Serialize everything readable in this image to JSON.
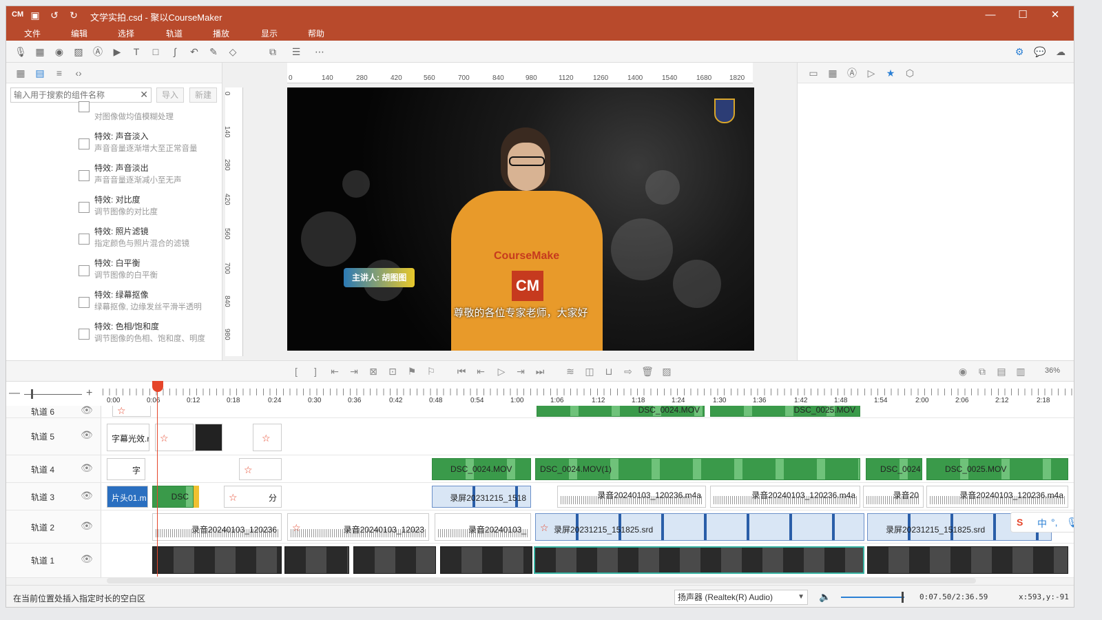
{
  "titlebar": {
    "logo": "CM",
    "title": "文学实拍.csd - 聚以CourseMaker",
    "minimize": "—",
    "maximize": "☐",
    "close": "✕"
  },
  "menu": [
    "文件",
    "编辑",
    "选择",
    "轨道",
    "播放",
    "显示",
    "帮助"
  ],
  "left_panel": {
    "search_placeholder": "输入用于搜索的组件名称",
    "import_label": "导入",
    "new_label": "新建",
    "effects": [
      {
        "name": "",
        "desc": "对图像做均值模糊处理"
      },
      {
        "name": "特效: 声音淡入",
        "desc": "声音音量逐渐增大至正常音量"
      },
      {
        "name": "特效: 声音淡出",
        "desc": "声音音量逐渐减小至无声"
      },
      {
        "name": "特效: 对比度",
        "desc": "调节图像的对比度"
      },
      {
        "name": "特效: 照片滤镜",
        "desc": "指定颜色与照片混合的滤镜"
      },
      {
        "name": "特效: 白平衡",
        "desc": "调节图像的白平衡"
      },
      {
        "name": "特效: 绿幕抠像",
        "desc": "绿幕抠像, 边缘发丝平滑半透明"
      },
      {
        "name": "特效: 色相/饱和度",
        "desc": "调节图像的色相、饱和度、明度"
      }
    ]
  },
  "canvas": {
    "hruler_ticks": [
      "0",
      "140",
      "280",
      "420",
      "560",
      "700",
      "840",
      "980",
      "1120",
      "1260",
      "1400",
      "1540",
      "1680",
      "1820"
    ],
    "vruler_ticks": [
      "0",
      "140",
      "280",
      "420",
      "560",
      "700",
      "840",
      "980"
    ],
    "hoodie_text": "CourseMake",
    "hoodie_logo": "CM",
    "speaker_label": "主讲人: 胡图图",
    "subtitle": "尊敬的各位专家老师，大家好"
  },
  "playback": {
    "zoom": "36%"
  },
  "timeline": {
    "ruler": [
      "0:00",
      "0:06",
      "0:12",
      "0:18",
      "0:24",
      "0:30",
      "0:36",
      "0:42",
      "0:48",
      "0:54",
      "1:00",
      "1:06",
      "1:12",
      "1:18",
      "1:24",
      "1:30",
      "1:36",
      "1:42",
      "1:48",
      "1:54",
      "2:00",
      "2:06",
      "2:12",
      "2:18"
    ],
    "tracks": [
      {
        "name": "轨道 6",
        "clips": [
          {
            "label": "DSC_0024.MOV",
            "kind": "green"
          },
          {
            "label": "DSC_0025.MOV",
            "kind": "green"
          }
        ]
      },
      {
        "name": "轨道 5",
        "clips": [
          {
            "label": "字幕光效.r",
            "kind": "plain"
          },
          {
            "label": "",
            "kind": "plain"
          },
          {
            "label": "",
            "kind": "plain"
          },
          {
            "label": "",
            "kind": "plain"
          }
        ]
      },
      {
        "name": "轨道 4",
        "clips": [
          {
            "label": "字",
            "kind": "plain"
          },
          {
            "label": "",
            "kind": "plain"
          },
          {
            "label": "DSC_0024.MOV",
            "kind": "green"
          },
          {
            "label": "DSC_0024.MOV(1)",
            "kind": "green"
          },
          {
            "label": "DSC_0024",
            "kind": "green"
          },
          {
            "label": "DSC_0025.MOV",
            "kind": "green"
          }
        ]
      },
      {
        "name": "轨道 3",
        "clips": [
          {
            "label": "片头01.m",
            "kind": "plain"
          },
          {
            "label": "DSC",
            "kind": "green"
          },
          {
            "label": "分",
            "kind": "plain"
          },
          {
            "label": "录屏20231215_1518",
            "kind": "screen"
          },
          {
            "label": "录音20240103_120236.m4a",
            "kind": "audio"
          },
          {
            "label": "录音20240103_120236.m4a",
            "kind": "audio"
          },
          {
            "label": "录音20",
            "kind": "audio"
          },
          {
            "label": "录音20240103_120236.m4a",
            "kind": "audio"
          }
        ]
      },
      {
        "name": "轨道 2",
        "clips": [
          {
            "label": "录音20240103_120236",
            "kind": "audio"
          },
          {
            "label": "录音20240103_12023",
            "kind": "audio"
          },
          {
            "label": "录音20240103_",
            "kind": "audio"
          },
          {
            "label": "录屏20231215_151825.srd",
            "kind": "screen"
          },
          {
            "label": "录屏20231215_151825.srd",
            "kind": "screen"
          }
        ]
      },
      {
        "name": "轨道 1",
        "clips": [
          {
            "label": "",
            "kind": "dark"
          },
          {
            "label": "",
            "kind": "dark"
          },
          {
            "label": "",
            "kind": "dark"
          },
          {
            "label": "",
            "kind": "dark"
          },
          {
            "label": "",
            "kind": "dark"
          },
          {
            "label": "",
            "kind": "dark"
          }
        ]
      }
    ]
  },
  "statusbar": {
    "message": "在当前位置处插入指定时长的空白区",
    "audio_device": "扬声器 (Realtek(R) Audio)",
    "time": "0:07.50/2:36.59",
    "coords": "x:593,y:-91"
  },
  "ime": {
    "logo": "S",
    "mode": "中",
    "punct": "°,"
  }
}
